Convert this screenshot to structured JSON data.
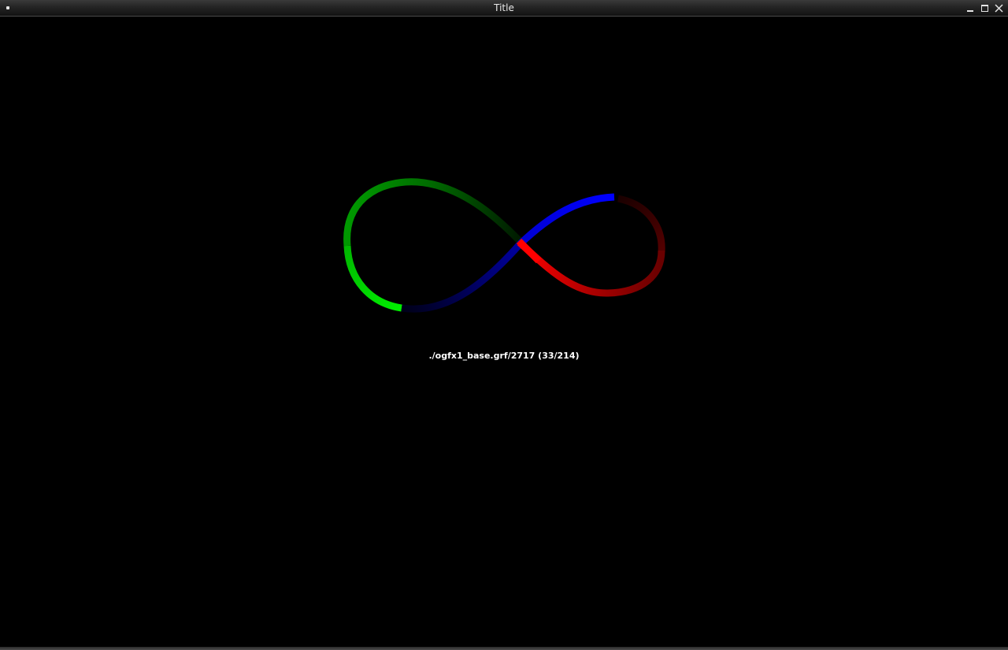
{
  "window": {
    "title": "Title",
    "controls": {
      "menu_icon": "window-menu-icon",
      "minimize_icon": "minimize-icon",
      "maximize_icon": "maximize-icon",
      "close_icon": "close-icon"
    }
  },
  "scene": {
    "status": "./ogfx1_base.grf/2717 (33/214)",
    "curve_segment_colors": {
      "upper_left_lobe": "#009a00",
      "lower_left_lobe": "#00e600",
      "center_lower_arc": "#000080",
      "upper_right_lobe": "#0000ff",
      "lower_right_lobe": "#ff0000",
      "right_tip": "#5a0000"
    }
  },
  "colors": {
    "background": "#000000",
    "text": "#ffffff",
    "titlebar": "#1c1c1c"
  }
}
